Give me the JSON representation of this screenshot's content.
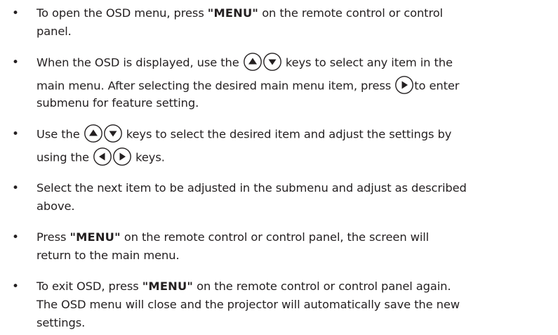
{
  "bullet_glyph": "•",
  "items": [
    {
      "lines": [
        {
          "a": "To open the OSD menu, press ",
          "kw": "\"MENU\"",
          "b": " on the remote control or control"
        },
        {
          "text": "panel."
        }
      ]
    },
    {
      "lines": [
        {
          "a": "When the OSD is displayed, use the ",
          "b": " keys to select any item in the"
        },
        {
          "a": "main menu. After selecting the desired main menu item, press ",
          "b": "to enter"
        },
        {
          "text": "submenu for feature setting."
        }
      ]
    },
    {
      "lines": [
        {
          "a": "Use the ",
          "b": " keys to select the desired item and adjust the settings by"
        },
        {
          "a": "using the ",
          "b": " keys."
        }
      ]
    },
    {
      "lines": [
        {
          "text": "Select the next item to be adjusted in the submenu and adjust as described"
        },
        {
          "text": "above."
        }
      ]
    },
    {
      "lines": [
        {
          "a": "Press ",
          "kw": "\"MENU\"",
          "b": " on the remote control or control panel, the screen will"
        },
        {
          "text": "return to the main menu."
        }
      ]
    },
    {
      "lines": [
        {
          "a": "To exit OSD, press ",
          "kw": "\"MENU\"",
          "b": " on the remote control or control panel again."
        },
        {
          "text": "The OSD menu will close and the projector will automatically save the new"
        },
        {
          "text": "settings."
        }
      ]
    }
  ],
  "key_icons": {
    "up": "up-arrow-key-icon",
    "down": "down-arrow-key-icon",
    "left": "left-arrow-key-icon",
    "right": "right-arrow-key-icon"
  }
}
